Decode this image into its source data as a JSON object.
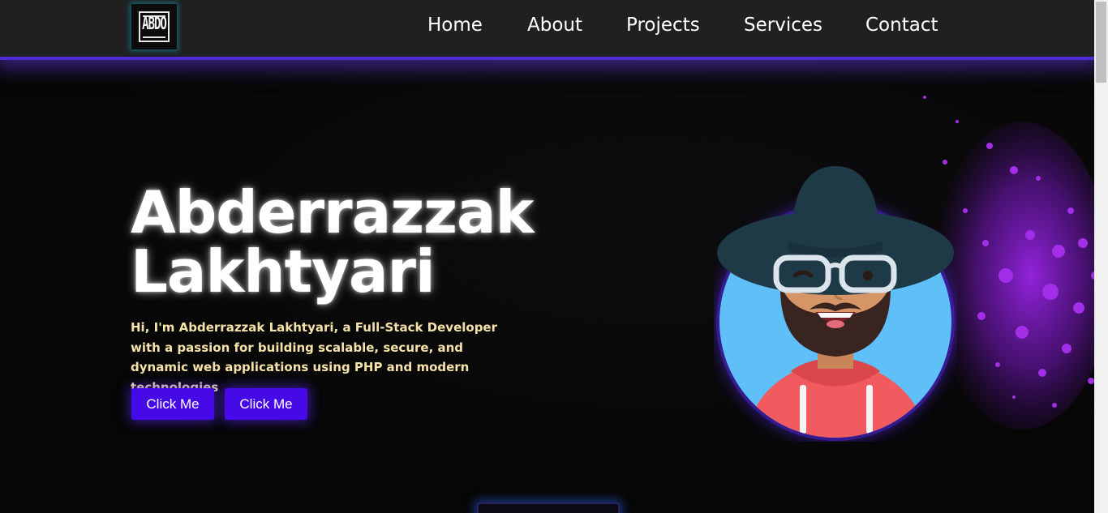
{
  "logo": {
    "text": "ABDO",
    "icon": "abdo-logo-icon"
  },
  "nav": {
    "items": [
      {
        "label": "Home"
      },
      {
        "label": "About"
      },
      {
        "label": "Projects"
      },
      {
        "label": "Services"
      },
      {
        "label": "Contact"
      }
    ]
  },
  "hero": {
    "name_line1": "Abderrazzak",
    "name_line2": "Lakhtyari",
    "description": "Hi, I'm Abderrazzak Lakhtyari, a Full-Stack Developer with a passion for building scalable, secure, and dynamic web applications using PHP and modern technologies",
    "buttons": [
      {
        "label": "Click Me"
      },
      {
        "label": "Click Me"
      }
    ]
  },
  "colors": {
    "accent": "#4609e8",
    "nav_glow": "#4f2bd8",
    "description_text": "#f4e2a8",
    "avatar_bg": "#5ec0f7",
    "hoodie": "#f15a5f",
    "hat": "#1f3a47",
    "splash": "#8a1fd6"
  }
}
